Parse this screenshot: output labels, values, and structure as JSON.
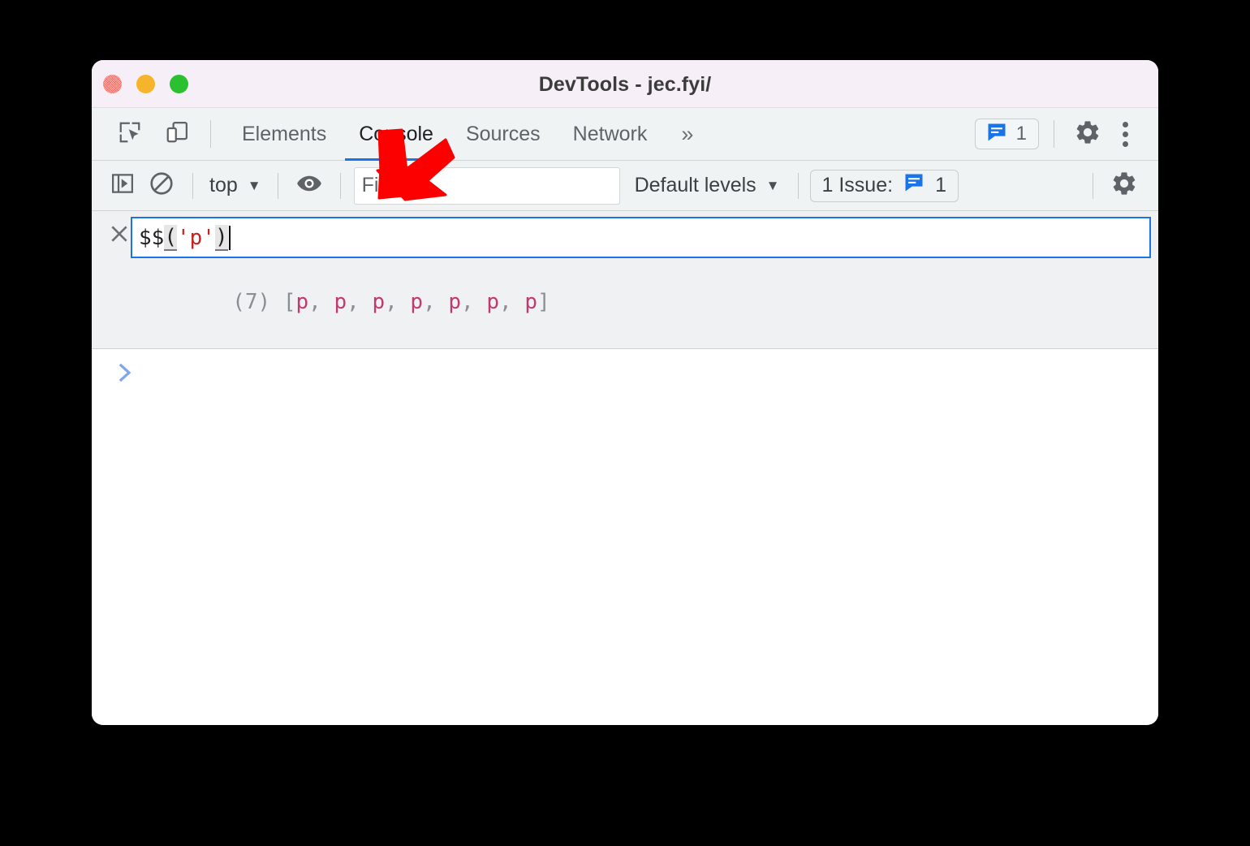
{
  "window": {
    "title": "DevTools - jec.fyi/",
    "traffic_lights": [
      "close",
      "minimize",
      "maximize"
    ]
  },
  "tabbar": {
    "inspect_icon": "inspect-element-icon",
    "device_icon": "device-toolbar-icon",
    "tabs": [
      {
        "label": "Elements",
        "active": false
      },
      {
        "label": "Console",
        "active": true
      },
      {
        "label": "Sources",
        "active": false
      },
      {
        "label": "Network",
        "active": false
      }
    ],
    "more_tabs": "»",
    "issues_badge": {
      "icon": "issue-message-icon",
      "count": "1"
    },
    "settings_icon": "gear-icon",
    "menu_icon": "kebab-menu-icon"
  },
  "console_toolbar": {
    "sidebar_toggle_icon": "console-sidebar-icon",
    "clear_console_icon": "clear-console-icon",
    "context": {
      "label": "top",
      "caret": "▼"
    },
    "live_expression_icon": "eye-icon",
    "filter": {
      "placeholder": "Filter",
      "value": ""
    },
    "levels": {
      "label": "Default levels",
      "caret": "▼"
    },
    "issues": {
      "label": "1 Issue:",
      "icon": "issue-message-icon",
      "count": "1"
    },
    "settings_icon": "gear-icon"
  },
  "console": {
    "clear_icon": "close-x-icon",
    "command": {
      "prefix": "$$",
      "open_paren": "(",
      "string": "'p'",
      "close_paren": ")"
    },
    "result": {
      "count": "(7)",
      "open_bracket": " [",
      "elements": [
        "p",
        "p",
        "p",
        "p",
        "p",
        "p",
        "p"
      ],
      "separator": ", ",
      "close_bracket": "]"
    },
    "prompt_chevron": "›"
  },
  "annotation": {
    "arrow": "red-arrow-pointing-down-left",
    "color": "#fc0000"
  },
  "colors": {
    "accent_blue": "#1a73e8",
    "titlebar_bg": "#f7eff7",
    "toolbar_bg": "#f0f3f4",
    "string_red": "#c5221f",
    "element_pink": "#c0396f",
    "annotation_red": "#fc0000"
  }
}
